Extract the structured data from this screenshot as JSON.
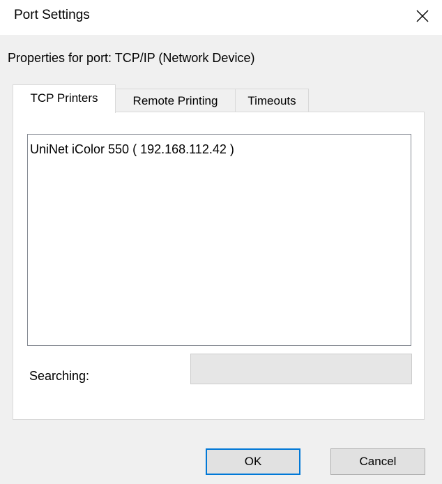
{
  "window": {
    "title": "Port Settings",
    "close_icon": "close-icon"
  },
  "properties_label": "Properties for port: TCP/IP (Network Device)",
  "tabs": [
    {
      "label": "TCP Printers",
      "active": true
    },
    {
      "label": "Remote Printing",
      "active": false
    },
    {
      "label": "Timeouts",
      "active": false
    }
  ],
  "printers": {
    "items": [
      "UniNet iColor 550 ( 192.168.112.42 )"
    ]
  },
  "searching": {
    "label": "Searching:",
    "value": ""
  },
  "buttons": {
    "ok": "OK",
    "cancel": "Cancel"
  },
  "colors": {
    "default_button_border": "#0078d7",
    "dialog_background": "#f0f0f0",
    "panel_background": "#ffffff"
  }
}
